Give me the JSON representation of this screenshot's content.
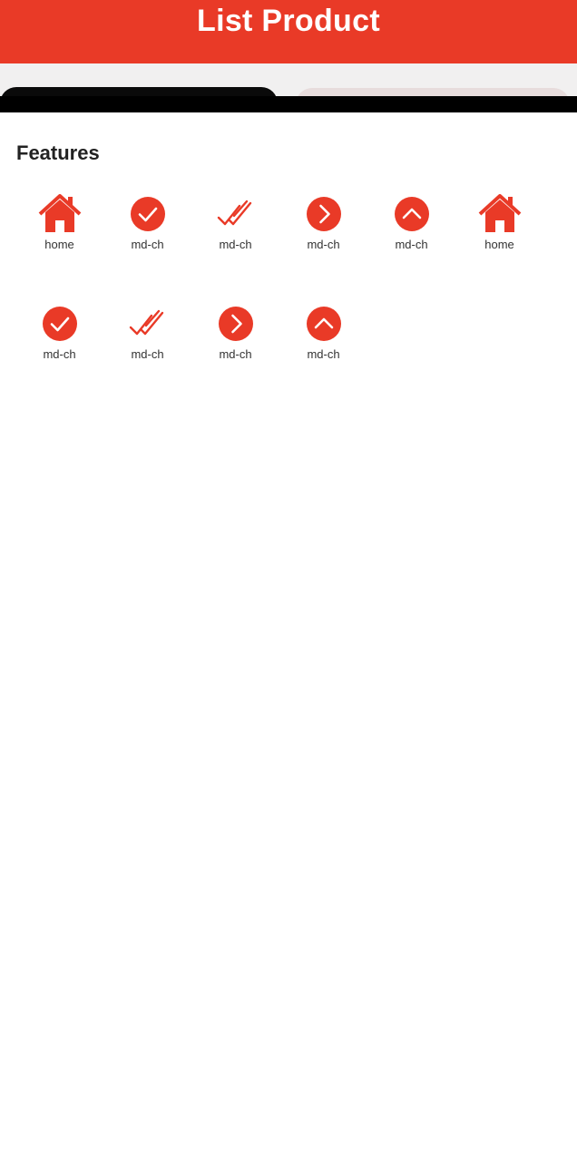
{
  "colors": {
    "accent": "#e93a27",
    "header_bg": "#e93a27",
    "header_text": "#ffffff"
  },
  "header": {
    "title": "List Product"
  },
  "features": {
    "title": "Features",
    "items": [
      {
        "icon": "home-icon",
        "label": "home"
      },
      {
        "icon": "check-circle-icon",
        "label": "md-ch"
      },
      {
        "icon": "double-check-icon",
        "label": "md-ch"
      },
      {
        "icon": "chevron-right-circle-icon",
        "label": "md-ch"
      },
      {
        "icon": "chevron-up-circle-icon",
        "label": "md-ch"
      },
      {
        "icon": "home-icon",
        "label": "home"
      },
      {
        "icon": "check-circle-icon",
        "label": "md-ch"
      },
      {
        "icon": "double-check-icon",
        "label": "md-ch"
      },
      {
        "icon": "chevron-right-circle-icon",
        "label": "md-ch"
      },
      {
        "icon": "chevron-up-circle-icon",
        "label": "md-ch"
      }
    ]
  }
}
